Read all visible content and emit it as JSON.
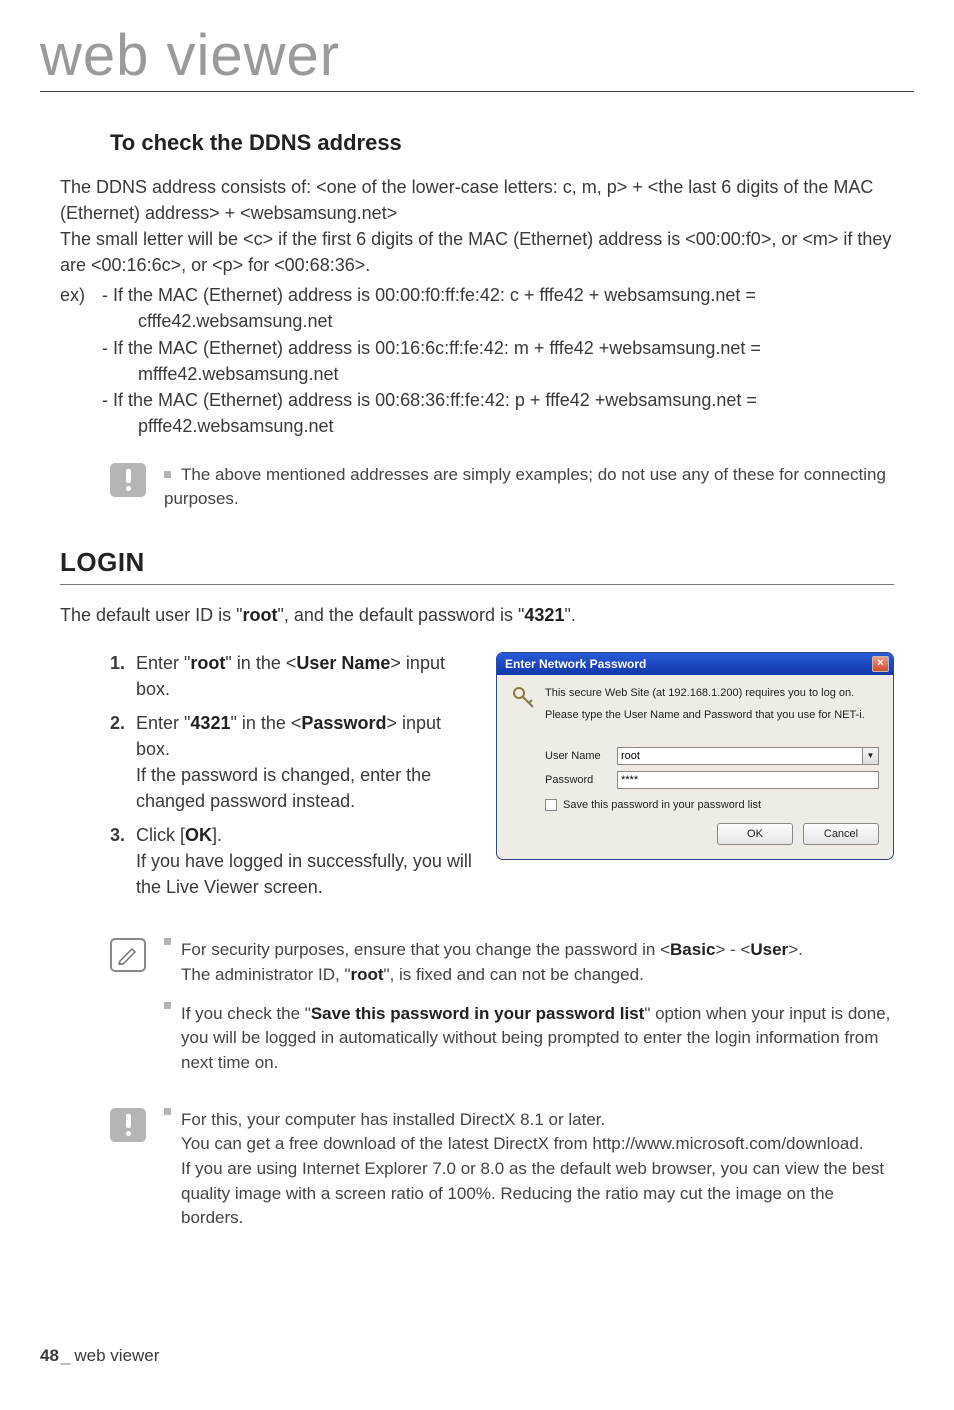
{
  "page_title": "web viewer",
  "ddns": {
    "heading": "To check the DDNS address",
    "p1": "The DDNS address consists of: <one of the lower-case letters: c, m, p> + <the last 6 digits of the MAC (Ethernet) address> + <websamsung.net>",
    "p2": "The small letter will be <c> if the first 6 digits of the MAC (Ethernet) address is <00:00:f0>, or <m> if they are <00:16:6c>, or <p> for <00:68:36>.",
    "ex_prefix": "ex)",
    "ex1a": "- If the MAC (Ethernet) address is 00:00:f0:ff:fe:42: c + fffe42 + websamsung.net =",
    "ex1b": "cfffe42.websamsung.net",
    "ex2a": "- If the MAC (Ethernet) address is 00:16:6c:ff:fe:42: m + fffe42 +websamsung.net =",
    "ex2b": "mfffe42.websamsung.net",
    "ex3a": "- If the MAC (Ethernet) address is 00:68:36:ff:fe:42: p + fffe42 +websamsung.net =",
    "ex3b": "pfffe42.websamsung.net",
    "note": "The above mentioned addresses are simply examples; do not use any of these for connecting purposes."
  },
  "login": {
    "heading": "LOGIN",
    "intro_pre": "The default user ID is \"",
    "intro_root": "root",
    "intro_mid": "\", and the default password is \"",
    "intro_pw": "4321",
    "intro_post": "\".",
    "s1num": "1.",
    "s1a": "Enter \"",
    "s1b": "root",
    "s1c": "\" in the <",
    "s1d": "User Name",
    "s1e": "> input box.",
    "s2num": "2.",
    "s2a": "Enter \"",
    "s2b": "4321",
    "s2c": "\" in the <",
    "s2d": "Password",
    "s2e": "> input box.",
    "s2f": "If the password is changed, enter the changed password instead.",
    "s3num": "3.",
    "s3a": "Click [",
    "s3b": "OK",
    "s3c": "].",
    "s3d": "If you have logged in successfully, you will the Live Viewer screen."
  },
  "dialog": {
    "title": "Enter Network Password",
    "close": "×",
    "msg1": "This secure Web Site (at 192.168.1.200) requires you to log on.",
    "msg2": "Please type the User Name and Password that you use for NET-i.",
    "user_label": "User Name",
    "user_value": "root",
    "pw_label": "Password",
    "pw_value": "****",
    "save_label": "Save this password in your password list",
    "ok": "OK",
    "cancel": "Cancel",
    "dropdown_glyph": "▼"
  },
  "tips": {
    "t1a": "For security purposes, ensure that you change the password in <",
    "t1b": "Basic",
    "t1c": "> - <",
    "t1d": "User",
    "t1e": ">.",
    "t1f_pre": "The administrator ID, \"",
    "t1f_b": "root",
    "t1f_post": "\", is fixed and can not be changed.",
    "t2a": "If you check the \"",
    "t2b": "Save this password in your password list",
    "t2c": "\" option when your input is done, you will be logged in automatically without being prompted to enter the login information from next time on.",
    "t3a": "For this, your computer has installed DirectX 8.1 or later.",
    "t3b": "You can get a free download of the latest DirectX from http://www.microsoft.com/download.",
    "t3c": "If you are using Internet Explorer 7.0 or 8.0 as the default web browser, you can view the best quality image with a screen ratio of 100%. Reducing the ratio may cut the image on the borders."
  },
  "footer": {
    "page_num": "48",
    "underscore": "_",
    "text": "web viewer"
  }
}
